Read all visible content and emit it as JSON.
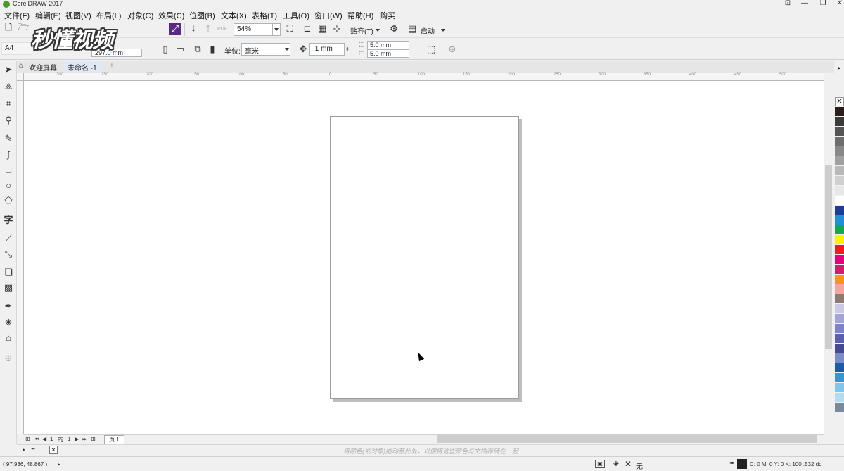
{
  "app": {
    "title": "CorelDRAW 2017"
  },
  "menu": [
    "文件(F)",
    "编辑(E)",
    "视图(V)",
    "布局(L)",
    "对象(C)",
    "效果(C)",
    "位图(B)",
    "文本(X)",
    "表格(T)",
    "工具(O)",
    "窗口(W)",
    "帮助(H)",
    "购买"
  ],
  "watermark": "秒懂视频",
  "toolbar1": {
    "zoom": "54%",
    "snap_label": "贴齐(T)",
    "launch_label": "启动"
  },
  "toolbar2": {
    "page_size": "A4",
    "width_value": "297.0 mm",
    "unit_label": "单位:",
    "unit_value": "毫米",
    "nudge_value": ".1 mm",
    "dup_x": "5.0 mm",
    "dup_y": "5.0 mm"
  },
  "tabs": {
    "welcome": "欢迎屏幕",
    "document": "未命名 -1"
  },
  "ruler": {
    "labels": [
      "300",
      "250",
      "200",
      "150",
      "100",
      "50",
      "0",
      "50",
      "100",
      "150",
      "200",
      "250",
      "300",
      "350",
      "400",
      "450",
      "500"
    ]
  },
  "pagenav": {
    "current": "1",
    "of_label": "的",
    "total": "1",
    "page_tab": "页 1"
  },
  "docpalette": {
    "hint": "将颜色(或对象)拖动至此处，以便将这些颜色与文档存储在一起"
  },
  "status": {
    "coords": "( 97.936, 48.867 )",
    "fill_label": "无",
    "color_info": "C: 0 M: 0 Y: 0 K: 100  .532 dd"
  },
  "palette_colors": [
    "#2b1d1a",
    "#3a3a3a",
    "#555555",
    "#6e6e6e",
    "#888888",
    "#a0a0a0",
    "#b8b8b8",
    "#d0d0d0",
    "#e8e8e8",
    "#ffffff",
    "#1c3d94",
    "#1d91d6",
    "#14a650",
    "#fff200",
    "#ed1c24",
    "#e6007e",
    "#cf1f6a",
    "#f7941d",
    "#f4a5a1",
    "#8c7b70",
    "#c9c9e6",
    "#a3a3d6",
    "#7f82c4",
    "#5c5fae",
    "#45498f",
    "#7b8cc9",
    "#1a5ca8",
    "#3399cc",
    "#7fc7e9",
    "#b2dcf0",
    "#7b8a99"
  ]
}
